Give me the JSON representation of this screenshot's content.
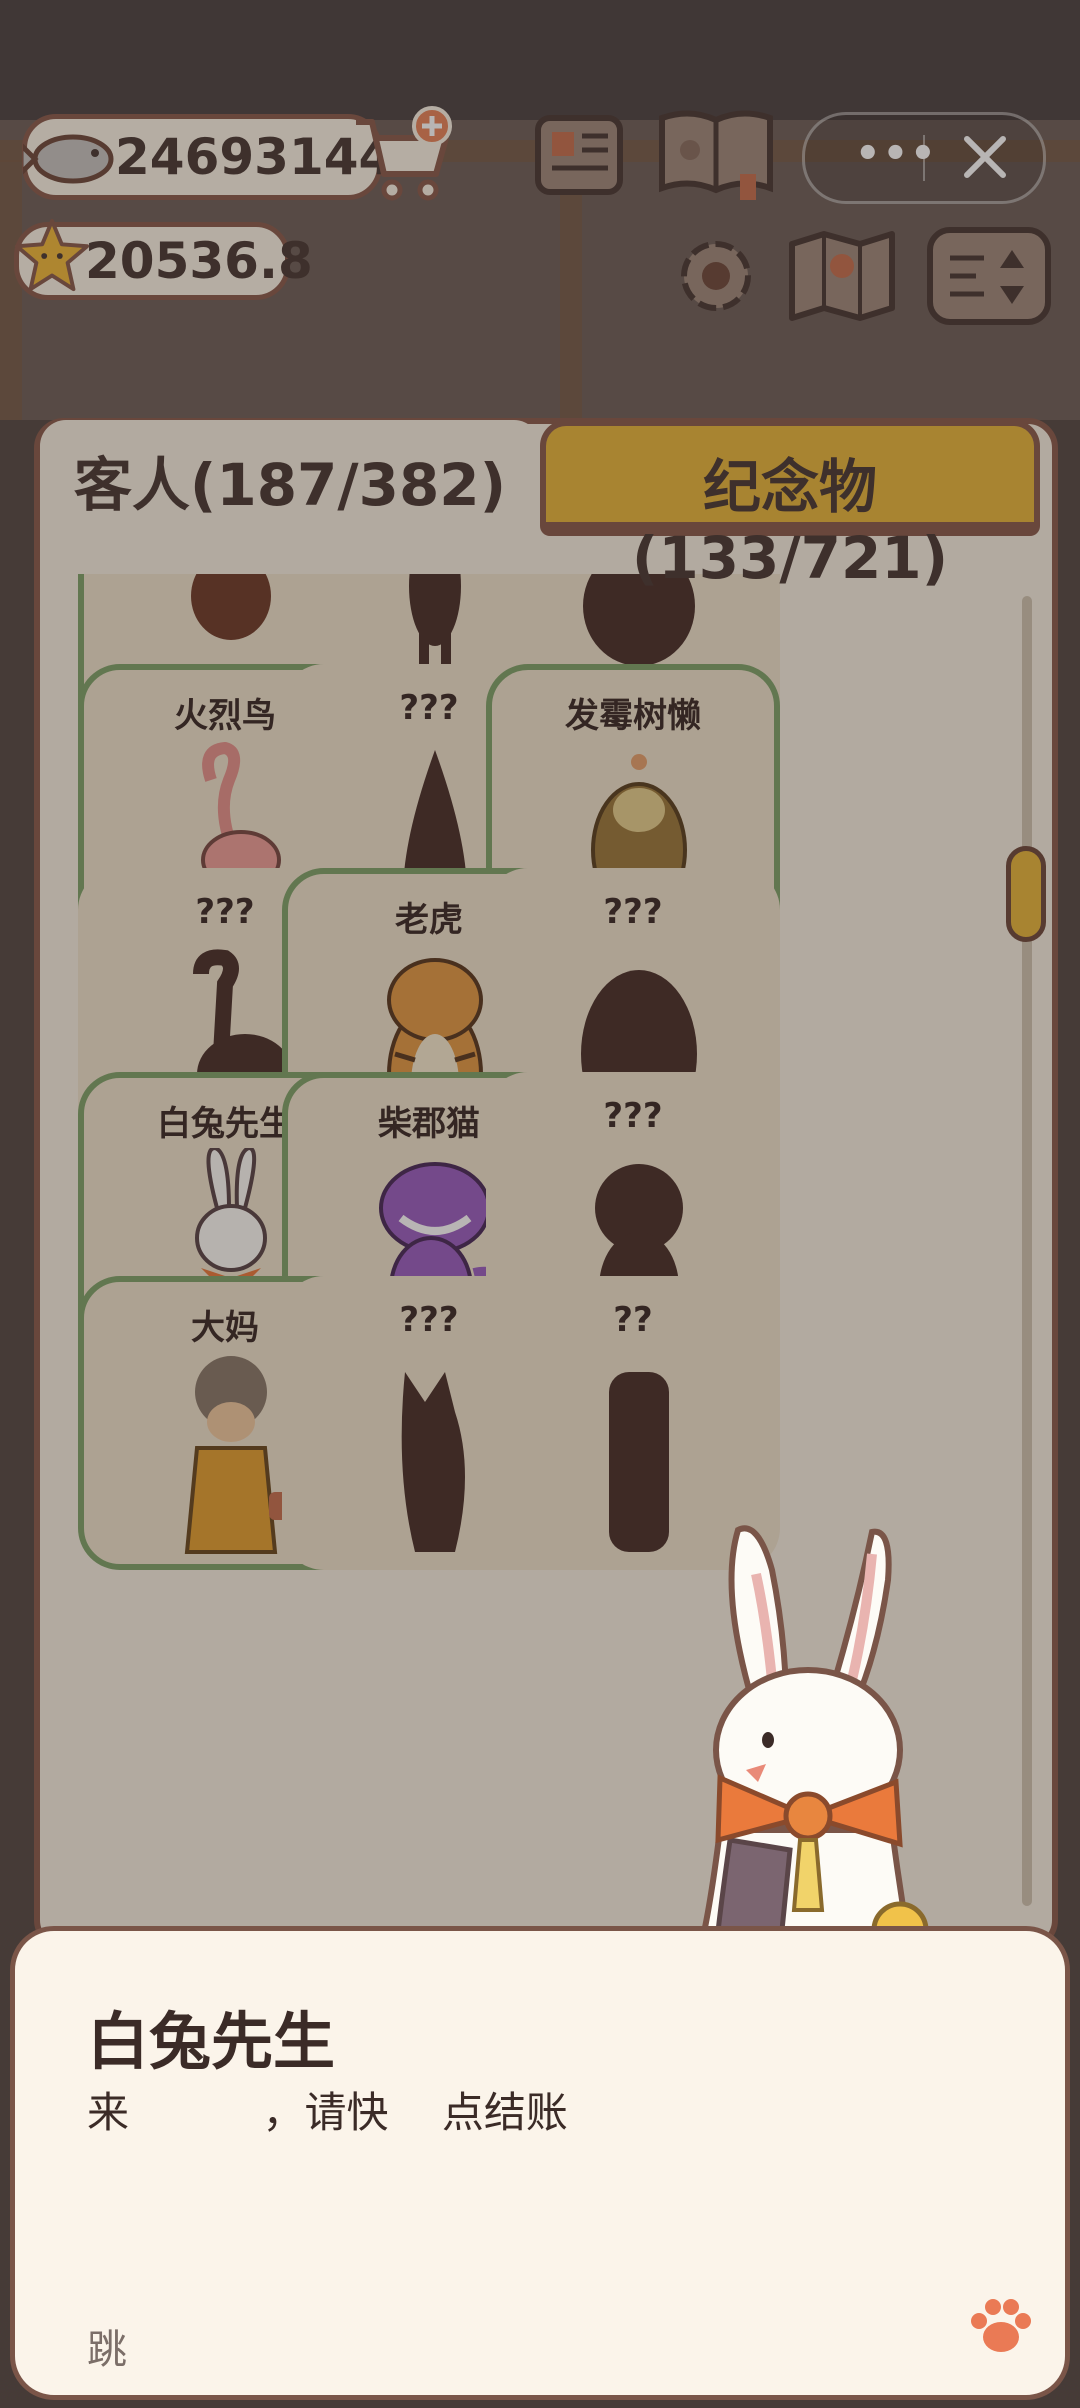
{
  "resources": {
    "fish": "24693144",
    "stars": "20536.8"
  },
  "tabs": {
    "guests": "客人(187/382)",
    "souvenirs": "纪念物(133/721)"
  },
  "guests": [
    {
      "name": "",
      "unlocked": true,
      "shape": "beetle"
    },
    {
      "name": "",
      "unlocked": false,
      "shape": "slim"
    },
    {
      "name": "",
      "unlocked": false,
      "shape": "blob"
    },
    {
      "name": "火烈鸟",
      "unlocked": true,
      "shape": "flamingo"
    },
    {
      "name": "???",
      "unlocked": false,
      "shape": "cone"
    },
    {
      "name": "发霉树懒",
      "unlocked": true,
      "shape": "sloth"
    },
    {
      "name": "???",
      "unlocked": false,
      "shape": "ostrich"
    },
    {
      "name": "老虎",
      "unlocked": true,
      "shape": "tiger"
    },
    {
      "name": "???",
      "unlocked": false,
      "shape": "bear"
    },
    {
      "name": "白兔先生",
      "unlocked": true,
      "shape": "rabbit"
    },
    {
      "name": "柴郡猫",
      "unlocked": true,
      "shape": "cheshire"
    },
    {
      "name": "???",
      "unlocked": false,
      "shape": "bush"
    },
    {
      "name": "大妈",
      "unlocked": true,
      "shape": "auntie"
    },
    {
      "name": "???",
      "unlocked": false,
      "shape": "wolf"
    },
    {
      "name": "??",
      "unlocked": false,
      "shape": "tall"
    }
  ],
  "dialog": {
    "speaker": "白兔先生",
    "text": "来          ，请快    点结账",
    "skip": "跳"
  },
  "colors": {
    "accent": "#e8b63d",
    "frame": "#8a5b4c",
    "unlockedBorder": "#7fa36a",
    "silhouette": "#4a302b"
  }
}
